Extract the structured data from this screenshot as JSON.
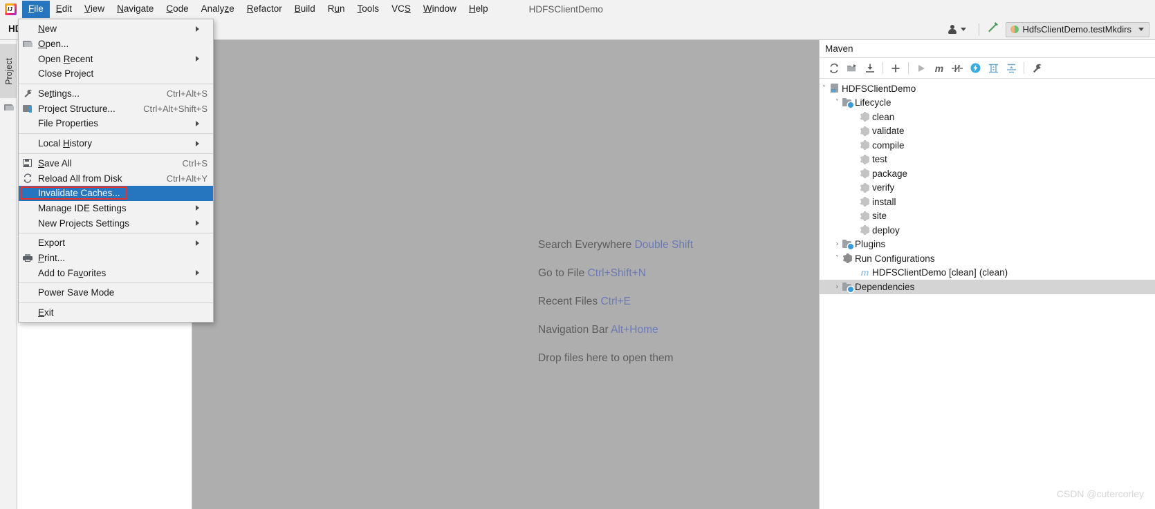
{
  "window": {
    "title": "HDFSClientDemo",
    "logo_icon": "intellij-idea-logo"
  },
  "menubar": {
    "items": [
      {
        "label": "File",
        "mnemonic": "F",
        "active": true
      },
      {
        "label": "Edit",
        "mnemonic": "E",
        "active": false
      },
      {
        "label": "View",
        "mnemonic": "V",
        "active": false
      },
      {
        "label": "Navigate",
        "mnemonic": "N",
        "active": false
      },
      {
        "label": "Code",
        "mnemonic": "C",
        "active": false
      },
      {
        "label": "Analyze",
        "mnemonic": "z",
        "active": false
      },
      {
        "label": "Refactor",
        "mnemonic": "R",
        "active": false
      },
      {
        "label": "Build",
        "mnemonic": "B",
        "active": false
      },
      {
        "label": "Run",
        "mnemonic": "u",
        "active": false
      },
      {
        "label": "Tools",
        "mnemonic": "T",
        "active": false
      },
      {
        "label": "VCS",
        "mnemonic": "S",
        "active": false
      },
      {
        "label": "Window",
        "mnemonic": "W",
        "active": false
      },
      {
        "label": "Help",
        "mnemonic": "H",
        "active": false
      }
    ]
  },
  "toolbar": {
    "project_label": "HD",
    "person_icon": "person-icon",
    "dropdown_icon": "chevron-down-icon",
    "hammer_icon": "build-hammer-icon",
    "run_config": {
      "name": "HdfsClientDemo.testMkdirs",
      "icon": "test-run-config-icon",
      "caret_icon": "chevron-down-icon"
    }
  },
  "left_strip": {
    "project_tab": "Project",
    "folder_icon": "folder-icon"
  },
  "file_menu": {
    "groups": [
      [
        {
          "id": "new",
          "label": "New",
          "mnemonic": "N",
          "submenu": true,
          "icon": null,
          "shortcut": ""
        },
        {
          "id": "open",
          "label": "Open...",
          "mnemonic": "O",
          "submenu": false,
          "icon": "folder-icon",
          "shortcut": ""
        },
        {
          "id": "open-recent",
          "label": "Open Recent",
          "mnemonic": "R",
          "submenu": true,
          "icon": null,
          "shortcut": ""
        },
        {
          "id": "close-project",
          "label": "Close Project",
          "mnemonic": "",
          "submenu": false,
          "icon": null,
          "shortcut": ""
        }
      ],
      [
        {
          "id": "settings",
          "label": "Settings...",
          "mnemonic": "t",
          "submenu": false,
          "icon": "wrench-icon",
          "shortcut": "Ctrl+Alt+S"
        },
        {
          "id": "project-structure",
          "label": "Project Structure...",
          "mnemonic": "",
          "submenu": false,
          "icon": "project-structure-icon",
          "shortcut": "Ctrl+Alt+Shift+S"
        },
        {
          "id": "file-properties",
          "label": "File Properties",
          "mnemonic": "",
          "submenu": true,
          "icon": null,
          "shortcut": ""
        }
      ],
      [
        {
          "id": "local-history",
          "label": "Local History",
          "mnemonic": "H",
          "submenu": true,
          "icon": null,
          "shortcut": ""
        }
      ],
      [
        {
          "id": "save-all",
          "label": "Save All",
          "mnemonic": "S",
          "submenu": false,
          "icon": "save-icon",
          "shortcut": "Ctrl+S"
        },
        {
          "id": "reload-all-from-disk",
          "label": "Reload All from Disk",
          "mnemonic": "",
          "submenu": false,
          "icon": "reload-icon",
          "shortcut": "Ctrl+Alt+Y"
        },
        {
          "id": "invalidate-caches",
          "label": "Invalidate Caches...",
          "mnemonic": "",
          "submenu": false,
          "icon": null,
          "shortcut": "",
          "highlighted": true,
          "annotated": true
        },
        {
          "id": "manage-ide-settings",
          "label": "Manage IDE Settings",
          "mnemonic": "",
          "submenu": true,
          "icon": null,
          "shortcut": ""
        },
        {
          "id": "new-projects-settings",
          "label": "New Projects Settings",
          "mnemonic": "",
          "submenu": true,
          "icon": null,
          "shortcut": ""
        }
      ],
      [
        {
          "id": "export",
          "label": "Export",
          "mnemonic": "",
          "submenu": true,
          "icon": null,
          "shortcut": ""
        },
        {
          "id": "print",
          "label": "Print...",
          "mnemonic": "P",
          "submenu": false,
          "icon": "print-icon",
          "shortcut": ""
        },
        {
          "id": "add-to-favorites",
          "label": "Add to Favorites",
          "mnemonic": "v",
          "submenu": true,
          "icon": null,
          "shortcut": ""
        }
      ],
      [
        {
          "id": "power-save-mode",
          "label": "Power Save Mode",
          "mnemonic": "",
          "submenu": false,
          "icon": null,
          "shortcut": ""
        }
      ],
      [
        {
          "id": "exit",
          "label": "Exit",
          "mnemonic": "E",
          "submenu": false,
          "icon": null,
          "shortcut": ""
        }
      ]
    ],
    "annotation_color": "#e8312a",
    "highlight_color": "#2675bf"
  },
  "editor_hints": [
    {
      "action": "Search Everywhere",
      "shortcut": "Double Shift"
    },
    {
      "action": "Go to File",
      "shortcut": "Ctrl+Shift+N"
    },
    {
      "action": "Recent Files",
      "shortcut": "Ctrl+E"
    },
    {
      "action": "Navigation Bar",
      "shortcut": "Alt+Home"
    },
    {
      "action": "Drop files here to open them",
      "shortcut": ""
    }
  ],
  "maven": {
    "title": "Maven",
    "toolbar": [
      {
        "id": "reload-all-maven-projects",
        "icon": "refresh-icon",
        "glyph": "↻"
      },
      {
        "id": "generate-sources-and-update-folders",
        "icon": "generate-sources-icon",
        "glyph": "▶"
      },
      {
        "id": "download-sources-and-documentation",
        "icon": "download-icon",
        "glyph": "⤓"
      },
      {
        "id": "add-maven-project",
        "icon": "plus-icon",
        "glyph": "+"
      },
      {
        "id": "run-build",
        "icon": "run-icon",
        "glyph": "▶"
      },
      {
        "id": "execute-maven-goal",
        "icon": "maven-m-icon",
        "glyph": "m"
      },
      {
        "id": "toggle-skip-tests",
        "icon": "skip-tests-icon",
        "glyph": "⫼"
      },
      {
        "id": "toggle-offline-mode",
        "icon": "offline-mode-icon",
        "glyph": "⚡"
      },
      {
        "id": "show-dependencies",
        "icon": "dependency-diagram-icon",
        "glyph": "⧉"
      },
      {
        "id": "collapse-all",
        "icon": "collapse-all-icon",
        "glyph": "⩓"
      },
      {
        "id": "maven-settings",
        "icon": "wrench-icon",
        "glyph": "⚒"
      }
    ],
    "tree": [
      {
        "label": "HDFSClientDemo",
        "depth": 0,
        "chevron": "expanded",
        "icon": "maven-project-icon",
        "selected": false
      },
      {
        "label": "Lifecycle",
        "depth": 1,
        "chevron": "expanded",
        "icon": "lifecycle-folder-icon",
        "selected": false
      },
      {
        "label": "clean",
        "depth": 2,
        "chevron": "none",
        "icon": "maven-goal-icon",
        "selected": false
      },
      {
        "label": "validate",
        "depth": 2,
        "chevron": "none",
        "icon": "maven-goal-icon",
        "selected": false
      },
      {
        "label": "compile",
        "depth": 2,
        "chevron": "none",
        "icon": "maven-goal-icon",
        "selected": false
      },
      {
        "label": "test",
        "depth": 2,
        "chevron": "none",
        "icon": "maven-goal-icon",
        "selected": false
      },
      {
        "label": "package",
        "depth": 2,
        "chevron": "none",
        "icon": "maven-goal-icon",
        "selected": false
      },
      {
        "label": "verify",
        "depth": 2,
        "chevron": "none",
        "icon": "maven-goal-icon",
        "selected": false
      },
      {
        "label": "install",
        "depth": 2,
        "chevron": "none",
        "icon": "maven-goal-icon",
        "selected": false
      },
      {
        "label": "site",
        "depth": 2,
        "chevron": "none",
        "icon": "maven-goal-icon",
        "selected": false
      },
      {
        "label": "deploy",
        "depth": 2,
        "chevron": "none",
        "icon": "maven-goal-icon",
        "selected": false
      },
      {
        "label": "Plugins",
        "depth": 1,
        "chevron": "collapsed",
        "icon": "plugins-folder-icon",
        "selected": false
      },
      {
        "label": "Run Configurations",
        "depth": 1,
        "chevron": "expanded",
        "icon": "run-configurations-icon",
        "selected": false
      },
      {
        "label": "HDFSClientDemo [clean]",
        "suffix": " (clean)",
        "depth": 2,
        "chevron": "none",
        "icon": "maven-m-icon",
        "selected": false
      },
      {
        "label": "Dependencies",
        "depth": 1,
        "chevron": "collapsed",
        "icon": "dependencies-folder-icon",
        "selected": true
      }
    ]
  },
  "watermark": "CSDN @cutercorley"
}
